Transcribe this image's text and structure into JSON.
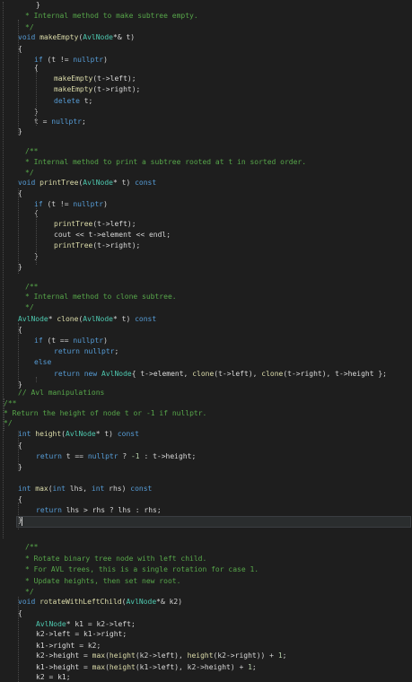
{
  "colors": {
    "background": "#1e1e1e",
    "comment": "#57a64a",
    "keyword": "#569cd6",
    "function": "#dcdcaa",
    "type": "#4ec9b0",
    "number": "#b5cea8",
    "text": "#d4d4d4",
    "field": "#dadada"
  },
  "code_lines": [
    [
      [
        "cm",
        "* Internal method to make subtree empty."
      ]
    ],
    [
      [
        "cm",
        "*/"
      ]
    ],
    [
      [
        "kw",
        "void "
      ],
      [
        "fn",
        "makeEmpty"
      ],
      [
        "tx",
        "("
      ],
      [
        "ty",
        "AvlNode"
      ],
      [
        "tx",
        "*& t)"
      ]
    ],
    [
      [
        "tx",
        "{"
      ]
    ],
    [
      [
        "kw",
        "if"
      ],
      [
        "tx",
        " (t != "
      ],
      [
        "kw",
        "nullptr"
      ],
      [
        "tx",
        ")"
      ]
    ],
    [
      [
        "tx",
        "{"
      ]
    ],
    [
      [
        "fn",
        "makeEmpty"
      ],
      [
        "tx",
        "(t->"
      ],
      [
        "fd",
        "left"
      ],
      [
        "tx",
        ");"
      ]
    ],
    [
      [
        "fn",
        "makeEmpty"
      ],
      [
        "tx",
        "(t->"
      ],
      [
        "fd",
        "right"
      ],
      [
        "tx",
        ");"
      ]
    ],
    [
      [
        "kw",
        "delete"
      ],
      [
        "tx",
        " t;"
      ]
    ],
    [
      [
        "tx",
        "}"
      ]
    ],
    [
      [
        "tx",
        "t = "
      ],
      [
        "kw",
        "nullptr"
      ],
      [
        "tx",
        ";"
      ]
    ],
    [
      [
        "tx",
        "}"
      ]
    ],
    [],
    [
      [
        "cm",
        "/**"
      ]
    ],
    [
      [
        "cm",
        "* Internal method to print a subtree rooted at t in sorted order."
      ]
    ],
    [
      [
        "cm",
        "*/"
      ]
    ],
    [
      [
        "kw",
        "void "
      ],
      [
        "fn",
        "printTree"
      ],
      [
        "tx",
        "("
      ],
      [
        "ty",
        "AvlNode"
      ],
      [
        "tx",
        "* t) "
      ],
      [
        "kw",
        "const"
      ]
    ],
    [
      [
        "tx",
        "{"
      ]
    ],
    [
      [
        "kw",
        "if"
      ],
      [
        "tx",
        " (t != "
      ],
      [
        "kw",
        "nullptr"
      ],
      [
        "tx",
        ")"
      ]
    ],
    [
      [
        "tx",
        "{"
      ]
    ],
    [
      [
        "fn",
        "printTree"
      ],
      [
        "tx",
        "(t->"
      ],
      [
        "fd",
        "left"
      ],
      [
        "tx",
        ");"
      ]
    ],
    [
      [
        "tx",
        "cout << t->"
      ],
      [
        "fd",
        "element"
      ],
      [
        "tx",
        " << endl;"
      ]
    ],
    [
      [
        "fn",
        "printTree"
      ],
      [
        "tx",
        "(t->"
      ],
      [
        "fd",
        "right"
      ],
      [
        "tx",
        ");"
      ]
    ],
    [
      [
        "tx",
        "}"
      ]
    ],
    [
      [
        "tx",
        "}"
      ]
    ],
    [],
    [
      [
        "cm",
        "/**"
      ]
    ],
    [
      [
        "cm",
        "* Internal method to clone subtree."
      ]
    ],
    [
      [
        "cm",
        "*/"
      ]
    ],
    [
      [
        "ty",
        "AvlNode"
      ],
      [
        "tx",
        "* "
      ],
      [
        "fn",
        "clone"
      ],
      [
        "tx",
        "("
      ],
      [
        "ty",
        "AvlNode"
      ],
      [
        "tx",
        "* t) "
      ],
      [
        "kw",
        "const"
      ]
    ],
    [
      [
        "tx",
        "{"
      ]
    ],
    [
      [
        "kw",
        "if"
      ],
      [
        "tx",
        " (t == "
      ],
      [
        "kw",
        "nullptr"
      ],
      [
        "tx",
        ")"
      ]
    ],
    [
      [
        "kw",
        "return"
      ],
      [
        "tx",
        " "
      ],
      [
        "kw",
        "nullptr"
      ],
      [
        "tx",
        ";"
      ]
    ],
    [
      [
        "kw",
        "else"
      ]
    ],
    [
      [
        "kw",
        "return"
      ],
      [
        "tx",
        " "
      ],
      [
        "kw",
        "new"
      ],
      [
        "tx",
        " "
      ],
      [
        "ty",
        "AvlNode"
      ],
      [
        "tx",
        "{ t->"
      ],
      [
        "fd",
        "element"
      ],
      [
        "tx",
        ", "
      ],
      [
        "fn",
        "clone"
      ],
      [
        "tx",
        "(t->"
      ],
      [
        "fd",
        "left"
      ],
      [
        "tx",
        "), "
      ],
      [
        "fn",
        "clone"
      ],
      [
        "tx",
        "(t->"
      ],
      [
        "fd",
        "right"
      ],
      [
        "tx",
        "), t->"
      ],
      [
        "fd",
        "height"
      ],
      [
        "tx",
        " };"
      ]
    ],
    [
      [
        "tx",
        "}"
      ]
    ],
    [
      [
        "cm",
        "// Avl manipulations"
      ]
    ],
    [
      [
        "cm",
        "/**"
      ]
    ],
    [
      [
        "cm",
        "* Return the height of node t or -1 if nullptr."
      ]
    ],
    [
      [
        "cm",
        "*/"
      ]
    ],
    [
      [
        "kw",
        "int "
      ],
      [
        "fn",
        "height"
      ],
      [
        "tx",
        "("
      ],
      [
        "ty",
        "AvlNode"
      ],
      [
        "tx",
        "* t) "
      ],
      [
        "kw",
        "const"
      ]
    ],
    [
      [
        "tx",
        "{"
      ]
    ],
    [
      [
        "kw",
        "return"
      ],
      [
        "tx",
        " t == "
      ],
      [
        "kw",
        "nullptr"
      ],
      [
        "tx",
        " ? "
      ],
      [
        "nm",
        "-1"
      ],
      [
        "tx",
        " : t->"
      ],
      [
        "fd",
        "height"
      ],
      [
        "tx",
        ";"
      ]
    ],
    [
      [
        "tx",
        "}"
      ]
    ],
    [],
    [
      [
        "kw",
        "int "
      ],
      [
        "fn",
        "max"
      ],
      [
        "tx",
        "("
      ],
      [
        "kw",
        "int"
      ],
      [
        "tx",
        " lhs, "
      ],
      [
        "kw",
        "int"
      ],
      [
        "tx",
        " rhs) "
      ],
      [
        "kw",
        "const"
      ]
    ],
    [
      [
        "tx",
        "{"
      ]
    ],
    [
      [
        "kw",
        "return"
      ],
      [
        "tx",
        " lhs > rhs ? lhs : rhs;"
      ]
    ],
    [
      [
        "tx",
        "}"
      ]
    ],
    [],
    [],
    [
      [
        "cm",
        "/**"
      ]
    ],
    [
      [
        "cm",
        "* Rotate binary tree node with left child."
      ]
    ],
    [
      [
        "cm",
        "* For AVL trees, this is a single rotation for case 1."
      ]
    ],
    [
      [
        "cm",
        "* Update heights, then set new root."
      ]
    ],
    [
      [
        "cm",
        "*/"
      ]
    ],
    [
      [
        "kw",
        "void "
      ],
      [
        "fn",
        "rotateWithLeftChild"
      ],
      [
        "tx",
        "("
      ],
      [
        "ty",
        "AvlNode"
      ],
      [
        "tx",
        "*& k2)"
      ]
    ],
    [
      [
        "tx",
        "{"
      ]
    ],
    [
      [
        "ty",
        "AvlNode"
      ],
      [
        "tx",
        "* "
      ],
      [
        "fd",
        "k1"
      ],
      [
        "tx",
        " = k2->"
      ],
      [
        "fd",
        "left"
      ],
      [
        "tx",
        ";"
      ]
    ],
    [
      [
        "tx",
        "k2->"
      ],
      [
        "fd",
        "left"
      ],
      [
        "tx",
        " = "
      ],
      [
        "fd",
        "k1"
      ],
      [
        "tx",
        "->"
      ],
      [
        "fd",
        "right"
      ],
      [
        "tx",
        ";"
      ]
    ],
    [
      [
        "fd",
        "k1"
      ],
      [
        "tx",
        "->"
      ],
      [
        "fd",
        "right"
      ],
      [
        "tx",
        " = k2;"
      ]
    ],
    [
      [
        "tx",
        "k2->"
      ],
      [
        "fd",
        "height"
      ],
      [
        "tx",
        " = "
      ],
      [
        "fn",
        "max"
      ],
      [
        "tx",
        "("
      ],
      [
        "fn",
        "height"
      ],
      [
        "tx",
        "(k2->"
      ],
      [
        "fd",
        "left"
      ],
      [
        "tx",
        "), "
      ],
      [
        "fn",
        "height"
      ],
      [
        "tx",
        "(k2->"
      ],
      [
        "fd",
        "right"
      ],
      [
        "tx",
        ")) + "
      ],
      [
        "nm",
        "1"
      ],
      [
        "tx",
        ";"
      ]
    ],
    [
      [
        "fd",
        "k1"
      ],
      [
        "tx",
        "->"
      ],
      [
        "fd",
        "height"
      ],
      [
        "tx",
        " = "
      ],
      [
        "fn",
        "max"
      ],
      [
        "tx",
        "("
      ],
      [
        "fn",
        "height"
      ],
      [
        "tx",
        "("
      ],
      [
        "fd",
        "k1"
      ],
      [
        "tx",
        "->"
      ],
      [
        "fd",
        "left"
      ],
      [
        "tx",
        "), k2->"
      ],
      [
        "fd",
        "height"
      ],
      [
        "tx",
        ") + "
      ],
      [
        "nm",
        "1"
      ],
      [
        "tx",
        ";"
      ]
    ],
    [
      [
        "tx",
        "k2 = "
      ],
      [
        "fd",
        "k1"
      ],
      [
        "tx",
        ";"
      ]
    ],
    [
      [
        "tx",
        "}"
      ]
    ]
  ]
}
